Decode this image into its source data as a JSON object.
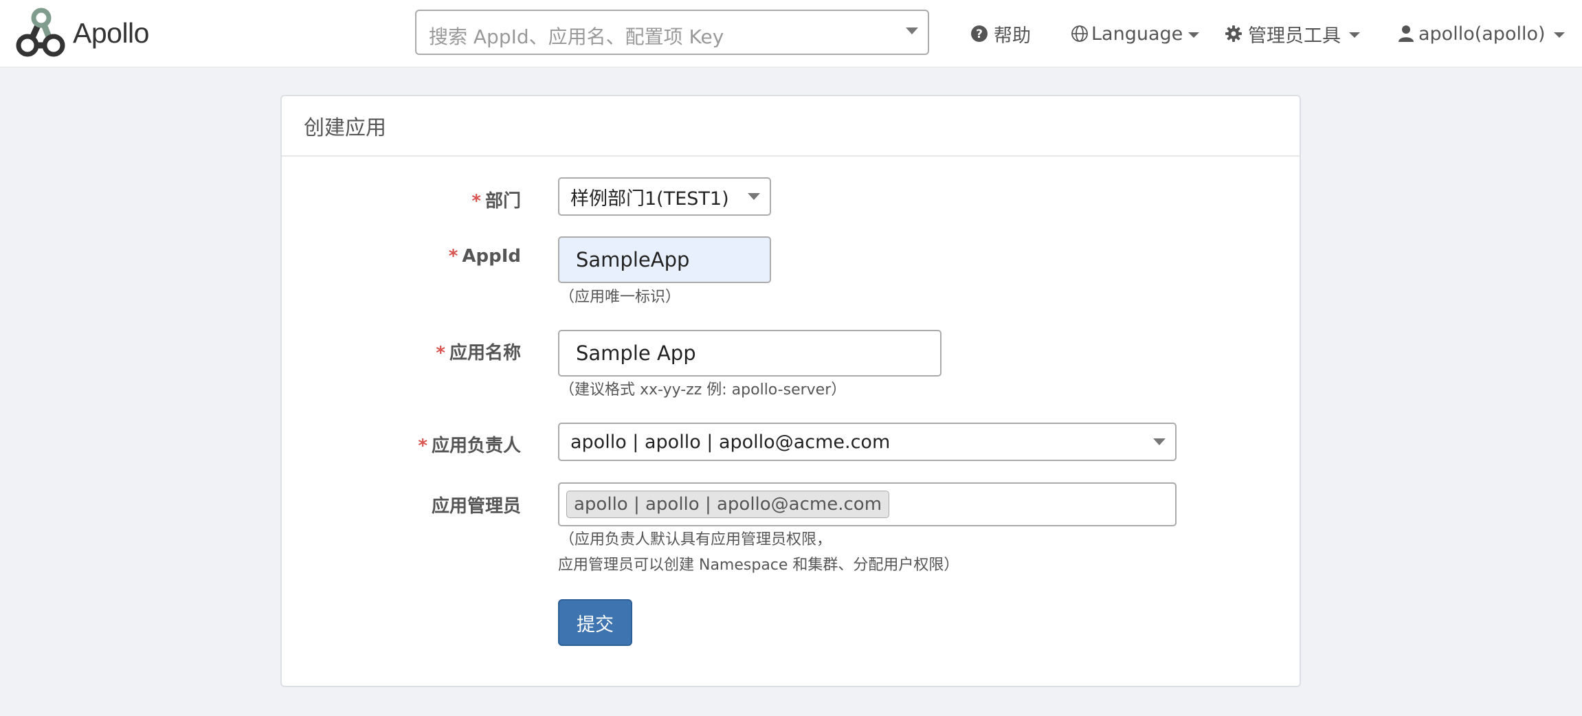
{
  "app": {
    "brand_name": "Apollo",
    "logo_icon": "apollo-logo-icon"
  },
  "navbar": {
    "search": {
      "placeholder": "搜索 AppId、应用名、配置项 Key"
    },
    "help_label": "帮助",
    "language_label": "Language",
    "admin_tools_label": "管理员工具",
    "user_label": "apollo(apollo)"
  },
  "panel": {
    "title": "创建应用"
  },
  "form": {
    "required_marker": "*",
    "department": {
      "label": "部门",
      "selected": "样例部门1(TEST1)"
    },
    "app_id": {
      "label": "AppId",
      "value": "SampleApp",
      "help": "（应用唯一标识）"
    },
    "app_name": {
      "label": "应用名称",
      "value": "Sample App",
      "help": "（建议格式 xx-yy-zz 例: apollo-server）"
    },
    "owner": {
      "label": "应用负责人",
      "selected": "apollo | apollo | apollo@acme.com"
    },
    "admins": {
      "label": "应用管理员",
      "tags": [
        "apollo | apollo | apollo@acme.com"
      ],
      "help_line1": "（应用负责人默认具有应用管理员权限，",
      "help_line2": "应用管理员可以创建 Namespace 和集群、分配用户权限）"
    },
    "submit_label": "提交"
  },
  "colors": {
    "page_background": "#f0f2f6",
    "primary_button": "#3e74b0",
    "required_marker": "#d9534f",
    "autofill_background": "#e8f0fe"
  }
}
